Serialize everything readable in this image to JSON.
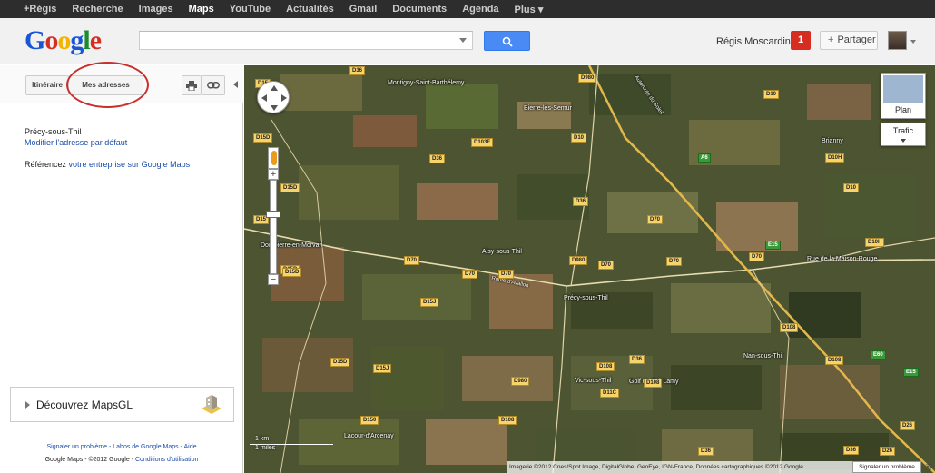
{
  "gbar": {
    "items": [
      "+Régis",
      "Recherche",
      "Images",
      "Maps",
      "YouTube",
      "Actualités",
      "Gmail",
      "Documents",
      "Agenda",
      "Plus ▾"
    ],
    "active": "Maps"
  },
  "header": {
    "logo": "Google",
    "search_value": "",
    "user_name": "Régis Moscardini",
    "notifications": "1",
    "share_label": "Partager"
  },
  "panel": {
    "tab_itineraire": "Itinéraire",
    "tab_mes_adresses": "Mes adresses",
    "location_title": "Précy-sous-Thil",
    "location_modify": "Modifier l'adresse par défaut",
    "ref_prefix": "Référencez ",
    "ref_link": "votre entreprise sur Google Maps",
    "mapsgl_label": "Découvrez MapsGL",
    "footer_links": "Signaler un problème - Labos de Google Maps - Aide",
    "footer_copyright": "Google Maps - ©2012 Google - ",
    "footer_conditions": "Conditions d'utilisation"
  },
  "map": {
    "mode_label": "Plan",
    "traffic_label": "Trafic",
    "scale_km": "1 km",
    "scale_miles": "1 miles",
    "attribution": "Imagerie ©2012 Cnes/Spot Image, DigitalGlobe, GeoEye, IGN-France, Données cartographiques ©2012 Google",
    "report_label": "Signaler un problème",
    "towns": [
      {
        "name": "Montigny-Saint-Barthélemy"
      },
      {
        "name": "Bierre-lès-Semur"
      },
      {
        "name": "Brianny"
      },
      {
        "name": "Dompierre-en-Morvan"
      },
      {
        "name": "Aisy-sous-Thil"
      },
      {
        "name": "Route d'Avallon"
      },
      {
        "name": "Précy-sous-Thil"
      },
      {
        "name": "Rue de la Maison-Rouge"
      },
      {
        "name": "Nan-sous-Thil"
      },
      {
        "name": "Vic-sous-Thil"
      },
      {
        "name": "Golf de Pré Lamy"
      },
      {
        "name": "Lacour-d'Arcenay"
      },
      {
        "name": "Autoroute du Soleil"
      }
    ],
    "roads": [
      "D36",
      "D15",
      "D980",
      "D10",
      "D15D",
      "D103F",
      "D36",
      "D10",
      "D10H",
      "D10",
      "D15D",
      "A6",
      "D15D",
      "E15",
      "D10H",
      "D70",
      "D36",
      "D980",
      "D70",
      "D70",
      "D70",
      "D70",
      "D70",
      "D15",
      "D15D",
      "D15J",
      "D70",
      "D108",
      "D15D",
      "D15J",
      "D980",
      "D108",
      "D11C",
      "D108",
      "D36",
      "E60",
      "E15",
      "D150",
      "D108",
      "D26",
      "D108",
      "D36",
      "D26",
      "D36"
    ]
  }
}
